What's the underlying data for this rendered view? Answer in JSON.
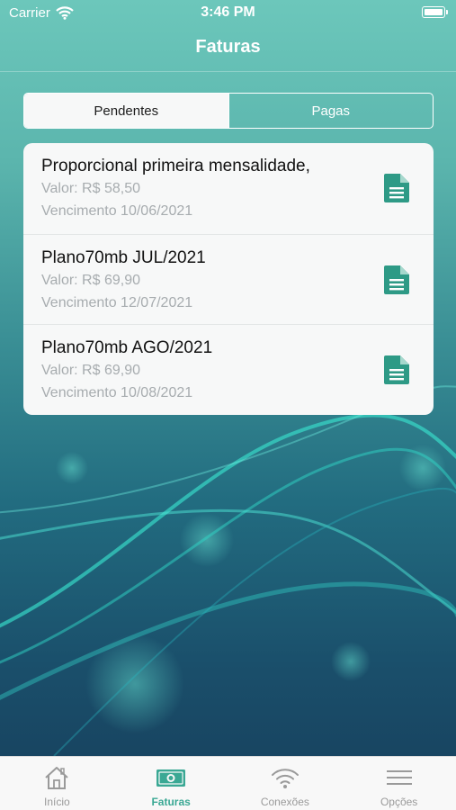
{
  "status_bar": {
    "carrier": "Carrier",
    "time": "3:46 PM"
  },
  "nav": {
    "title": "Faturas"
  },
  "segments": {
    "pending": "Pendentes",
    "paid": "Pagas",
    "selected": "Pendentes"
  },
  "invoices": [
    {
      "title": "Proporcional primeira mensalidade,",
      "value": "Valor: R$ 58,50",
      "due": "Vencimento 10/06/2021"
    },
    {
      "title": "Plano70mb JUL/2021",
      "value": "Valor: R$ 69,90",
      "due": "Vencimento 12/07/2021"
    },
    {
      "title": "Plano70mb AGO/2021",
      "value": "Valor: R$ 69,90",
      "due": "Vencimento 10/08/2021"
    }
  ],
  "tabs": [
    {
      "label": "Início",
      "icon": "home-icon"
    },
    {
      "label": "Faturas",
      "icon": "money-icon",
      "active": true
    },
    {
      "label": "Conexões",
      "icon": "wifi-icon"
    },
    {
      "label": "Opções",
      "icon": "menu-icon"
    }
  ],
  "colors": {
    "accent": "#3aa894",
    "doc_icon": "#2e9a86",
    "header_teal": "#6cc7bb"
  }
}
